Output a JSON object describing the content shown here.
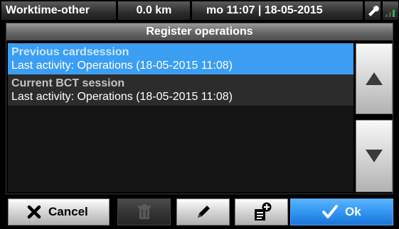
{
  "status_bar": {
    "activity": "Worktime-other",
    "distance": "0.0 km",
    "datetime": "mo 11:07 | 18-05-2015",
    "tool_icon": "wrench-icon",
    "signal_icon": "signal-bars-icon"
  },
  "panel": {
    "title": "Register operations",
    "items": [
      {
        "name": "Previous cardsession",
        "detail": "Last activity: Operations (18-05-2015 11:08)",
        "selected": true
      },
      {
        "name": "Current BCT session",
        "detail": "Last activity: Operations (18-05-2015 11:08)",
        "selected": false
      }
    ],
    "scroll_up_icon": "arrow-up-icon",
    "scroll_down_icon": "arrow-down-icon"
  },
  "buttons": {
    "cancel": {
      "label": "Cancel",
      "icon": "x-icon"
    },
    "delete": {
      "icon": "trash-icon",
      "enabled": false
    },
    "edit": {
      "icon": "pencil-icon"
    },
    "new": {
      "icon": "new-document-icon"
    },
    "ok": {
      "label": "Ok",
      "icon": "checkmark-icon"
    }
  },
  "colors": {
    "selection": "#3b9ef2",
    "ok_button": "#2e93f0"
  }
}
